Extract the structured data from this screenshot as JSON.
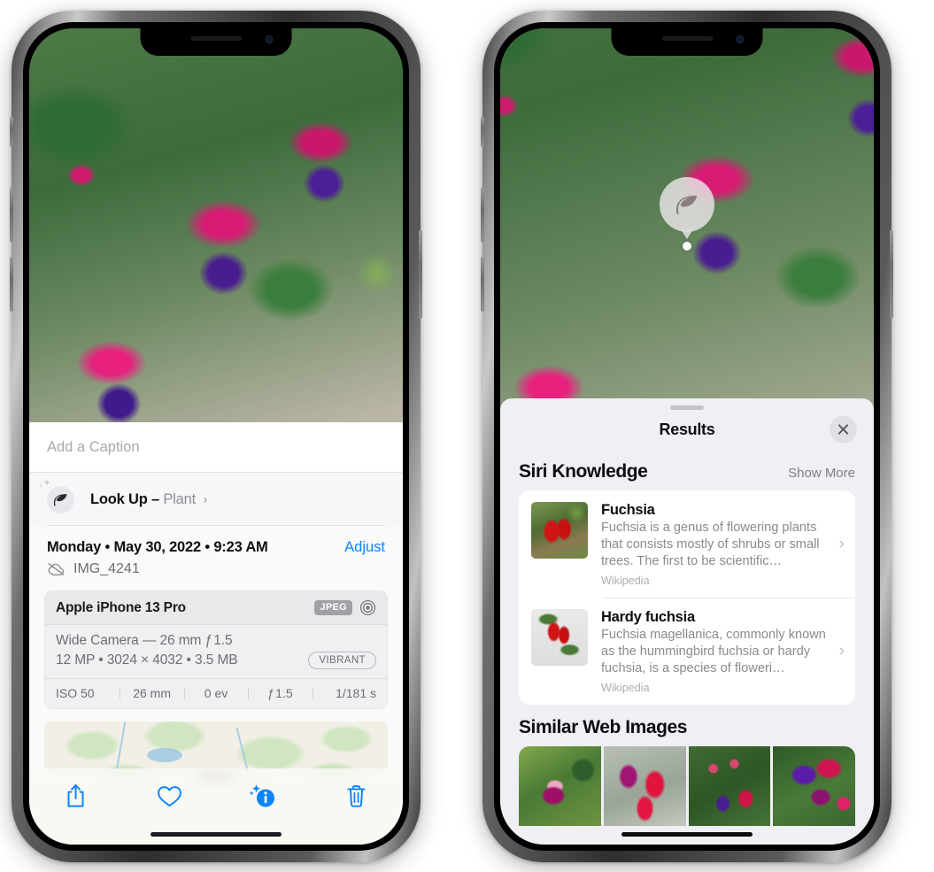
{
  "left_phone": {
    "photo_alt": "fuchsia-flowers-photo",
    "caption": {
      "placeholder": "Add a Caption",
      "value": ""
    },
    "lookup": {
      "icon": "leaf-icon",
      "sparkle_icon": "sparkles-icon",
      "label": "Look Up –",
      "subject": "Plant",
      "chevron": "›"
    },
    "date": {
      "text": "Monday • May 30, 2022 • 9:23 AM",
      "adjust_label": "Adjust",
      "cloud_icon": "icloud-slash-icon",
      "filename": "IMG_4241"
    },
    "metadata": {
      "device": "Apple iPhone 13 Pro",
      "format_badge": "JPEG",
      "raw_icon": "aperture-icon",
      "lens_line": "Wide Camera — 26 mm ƒ 1.5",
      "size_line": "12 MP • 3024 × 4032 • 3.5 MB",
      "style_badge": "VIBRANT",
      "exif": [
        "ISO 50",
        "26 mm",
        "0 ev",
        "ƒ 1.5",
        "1/181 s"
      ]
    },
    "map": {
      "name": "location-map",
      "pin": "photo-pin"
    },
    "toolbar": [
      {
        "name": "share-button",
        "icon": "share-icon"
      },
      {
        "name": "favorite-button",
        "icon": "heart-icon"
      },
      {
        "name": "info-button",
        "icon": "info-sparkles-icon",
        "active": true
      },
      {
        "name": "delete-button",
        "icon": "trash-icon"
      }
    ],
    "accent_color": "#0b84fe"
  },
  "right_phone": {
    "visual_lookup_pin": {
      "icon": "leaf-icon",
      "label": "plant-detected"
    },
    "sheet": {
      "title": "Results",
      "close_icon": "close-icon",
      "grabber": "sheet-grabber"
    },
    "siri_knowledge": {
      "title": "Siri Knowledge",
      "show_more": "Show More",
      "items": [
        {
          "title": "Fuchsia",
          "description": "Fuchsia is a genus of flowering plants that consists mostly of shrubs or small trees. The first to be scientific…",
          "source": "Wikipedia",
          "chevron": "›",
          "thumb": "fuchsia-thumbnail"
        },
        {
          "title": "Hardy fuchsia",
          "description": "Fuchsia magellanica, commonly known as the hummingbird fuchsia or hardy fuchsia, is a species of floweri…",
          "source": "Wikipedia",
          "chevron": "›",
          "thumb": "hardy-fuchsia-thumbnail"
        }
      ]
    },
    "similar_web_images": {
      "title": "Similar Web Images",
      "items": [
        {
          "name": "web-image-1"
        },
        {
          "name": "web-image-2"
        },
        {
          "name": "web-image-3"
        },
        {
          "name": "web-image-4"
        }
      ]
    }
  }
}
